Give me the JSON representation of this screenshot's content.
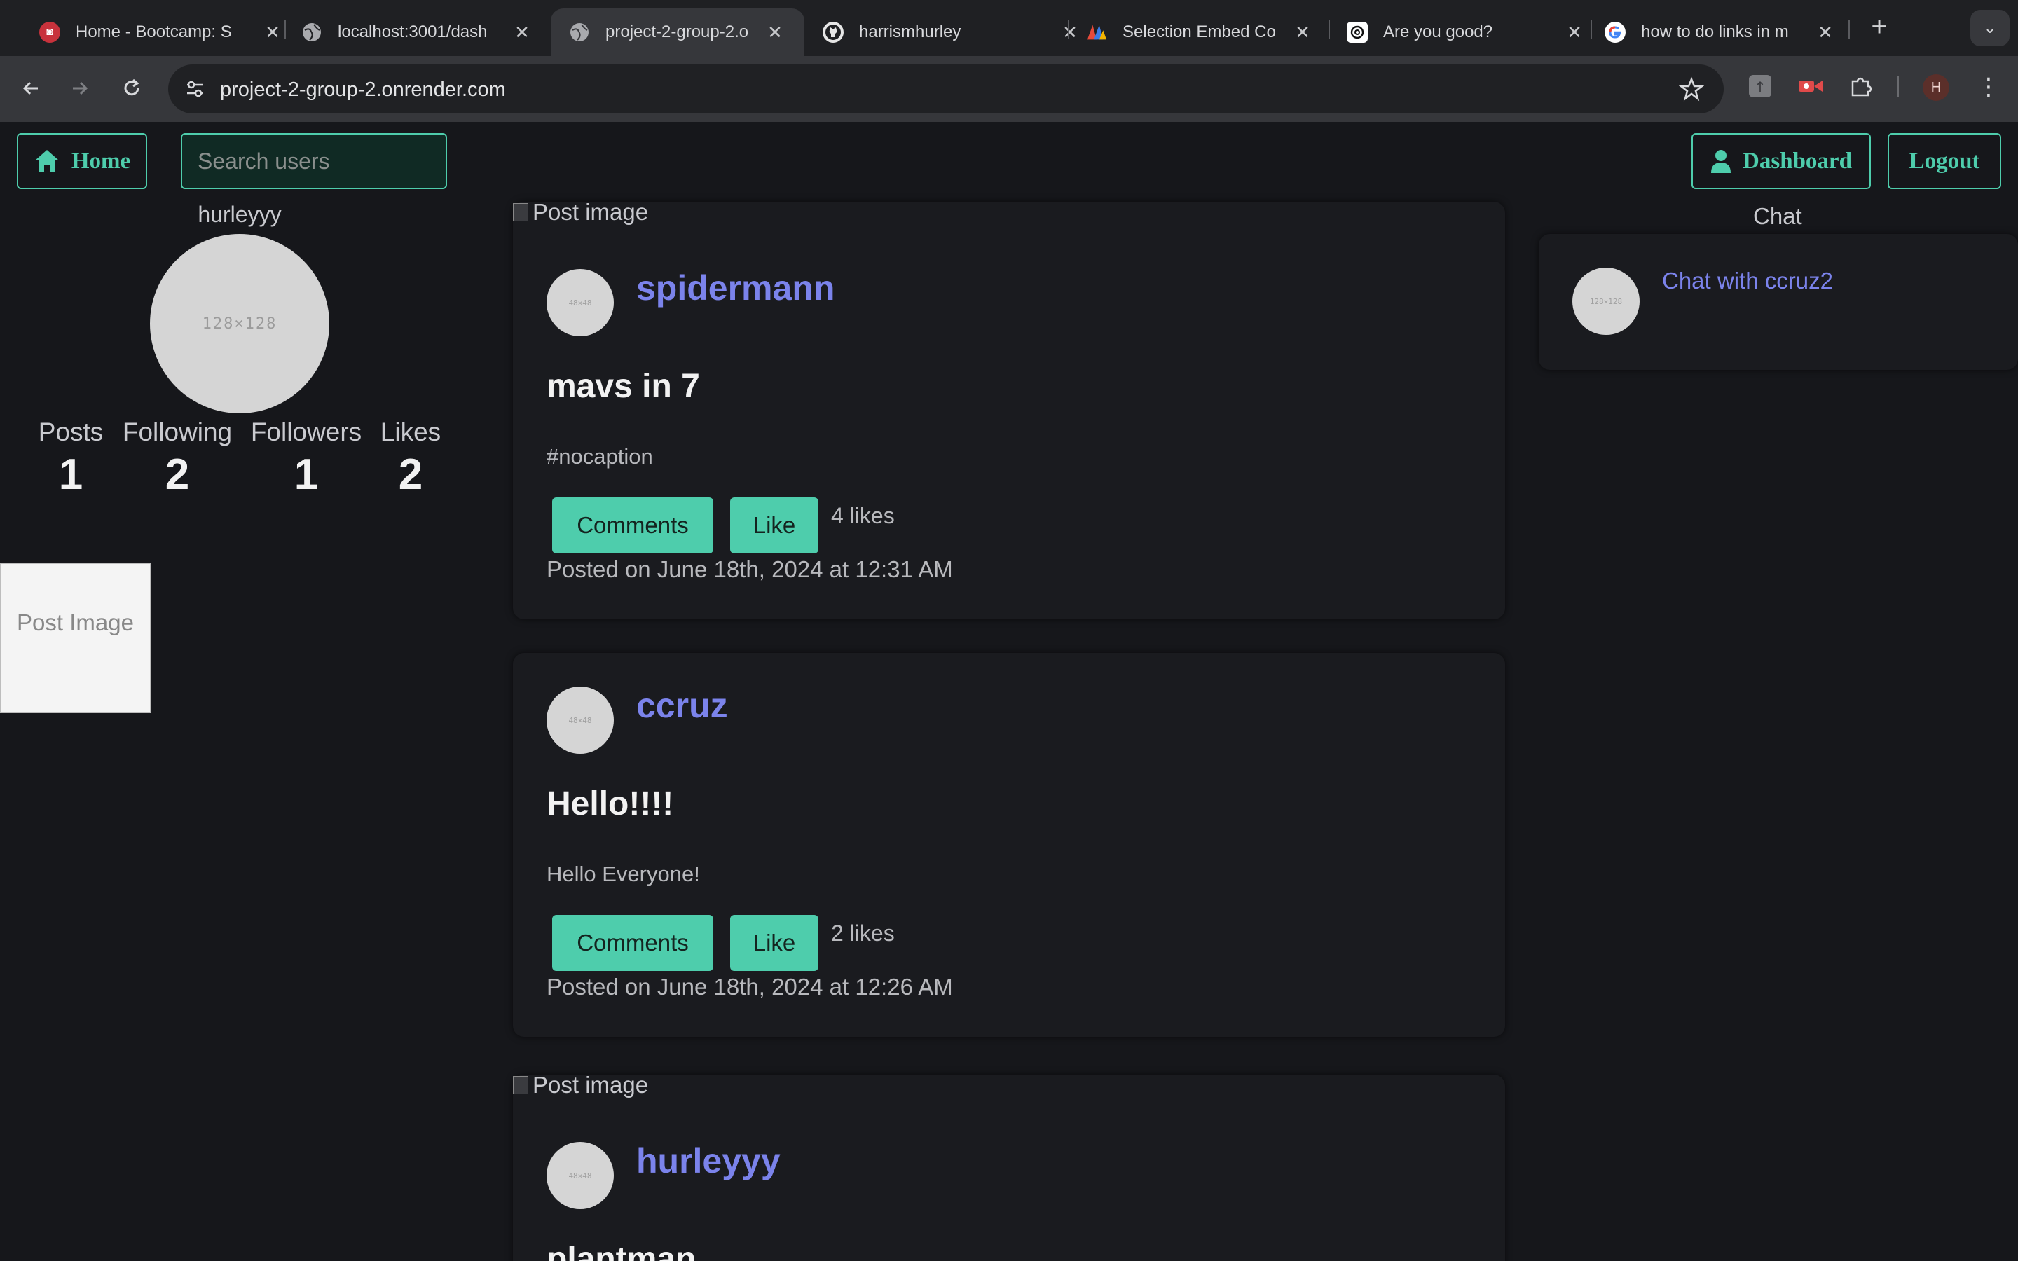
{
  "browser": {
    "tabs": [
      {
        "title": "Home - Bootcamp: S",
        "icon": "bootcamp-icon",
        "active": false
      },
      {
        "title": "localhost:3001/dash",
        "icon": "globe-icon",
        "active": false
      },
      {
        "title": "project-2-group-2.o",
        "icon": "globe-icon",
        "active": true
      },
      {
        "title": "harrismhurley",
        "icon": "github-icon",
        "active": false
      },
      {
        "title": "Selection Embed Co",
        "icon": "embed-icon",
        "active": false
      },
      {
        "title": "Are you good?",
        "icon": "chatgpt-icon",
        "active": false
      },
      {
        "title": "how to do links in m",
        "icon": "google-icon",
        "active": false
      }
    ],
    "url": "project-2-group-2.onrender.com",
    "profile_initial": "H"
  },
  "nav": {
    "home_label": "Home",
    "search_placeholder": "Search users",
    "dashboard_label": "Dashboard",
    "logout_label": "Logout"
  },
  "profile": {
    "username": "hurleyyy",
    "avatar_text": "128×128",
    "stats": [
      {
        "label": "Posts",
        "value": "1"
      },
      {
        "label": "Following",
        "value": "2"
      },
      {
        "label": "Followers",
        "value": "1"
      },
      {
        "label": "Likes",
        "value": "2"
      }
    ],
    "side_image_alt": "Post Image"
  },
  "posts": [
    {
      "image_alt": "Post image",
      "username": "spidermann",
      "title": "mavs in 7",
      "body": "#nocaption",
      "comments_label": "Comments",
      "like_label": "Like",
      "likes": "4 likes",
      "posted": "Posted on June 18th, 2024 at 12:31 AM"
    },
    {
      "image_alt": "",
      "username": "ccruz",
      "title": "Hello!!!!",
      "body": "Hello Everyone!",
      "comments_label": "Comments",
      "like_label": "Like",
      "likes": "2 likes",
      "posted": "Posted on June 18th, 2024 at 12:26 AM"
    },
    {
      "image_alt": "Post image",
      "username": "hurleyyy",
      "title": "plantman"
    }
  ],
  "avatar_small_text": "48×48",
  "chat": {
    "label": "Chat",
    "avatar_text": "128×128",
    "link": "Chat with ccruz2"
  },
  "colors": {
    "accent": "#4ecdac",
    "username": "#7b83eb",
    "background": "#16171b"
  }
}
